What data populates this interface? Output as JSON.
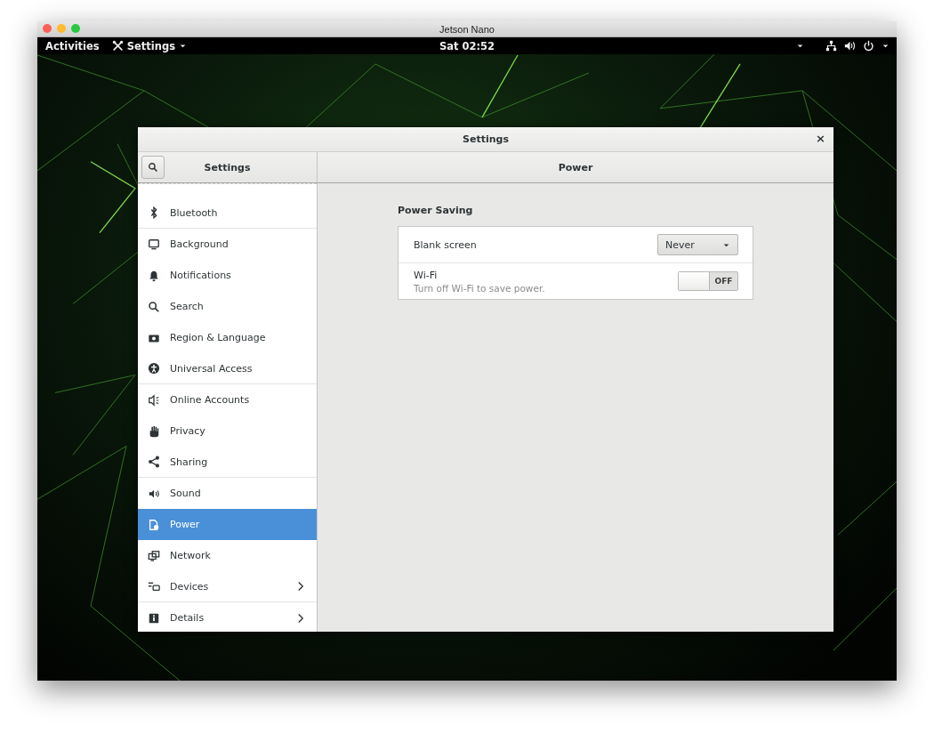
{
  "host_window": {
    "title": "Jetson Nano"
  },
  "top_bar": {
    "activities": "Activities",
    "app_menu": "Settings",
    "clock": "Sat 02:52"
  },
  "settings_window": {
    "title": "Settings",
    "close": "×",
    "sidebar": {
      "title": "Settings",
      "groups": [
        [
          {
            "label": "Bluetooth",
            "selected": false,
            "arrow": false
          }
        ],
        [
          {
            "label": "Background",
            "selected": false,
            "arrow": false
          },
          {
            "label": "Notifications",
            "selected": false,
            "arrow": false
          },
          {
            "label": "Search",
            "selected": false,
            "arrow": false
          },
          {
            "label": "Region & Language",
            "selected": false,
            "arrow": false
          },
          {
            "label": "Universal Access",
            "selected": false,
            "arrow": false
          }
        ],
        [
          {
            "label": "Online Accounts",
            "selected": false,
            "arrow": false
          },
          {
            "label": "Privacy",
            "selected": false,
            "arrow": false
          },
          {
            "label": "Sharing",
            "selected": false,
            "arrow": false
          }
        ],
        [
          {
            "label": "Sound",
            "selected": false,
            "arrow": false
          },
          {
            "label": "Power",
            "selected": true,
            "arrow": false
          },
          {
            "label": "Network",
            "selected": false,
            "arrow": false
          },
          {
            "label": "Devices",
            "selected": false,
            "arrow": true
          }
        ],
        [
          {
            "label": "Details",
            "selected": false,
            "arrow": true
          }
        ]
      ]
    },
    "panel": {
      "title": "Power",
      "section": "Power Saving",
      "rows": [
        {
          "kind": "dropdown",
          "label": "Blank screen",
          "value": "Never"
        },
        {
          "kind": "switch",
          "label": "Wi-Fi",
          "subtitle": "Turn off Wi-Fi to save power.",
          "on": false,
          "state_label": "OFF"
        }
      ]
    }
  }
}
